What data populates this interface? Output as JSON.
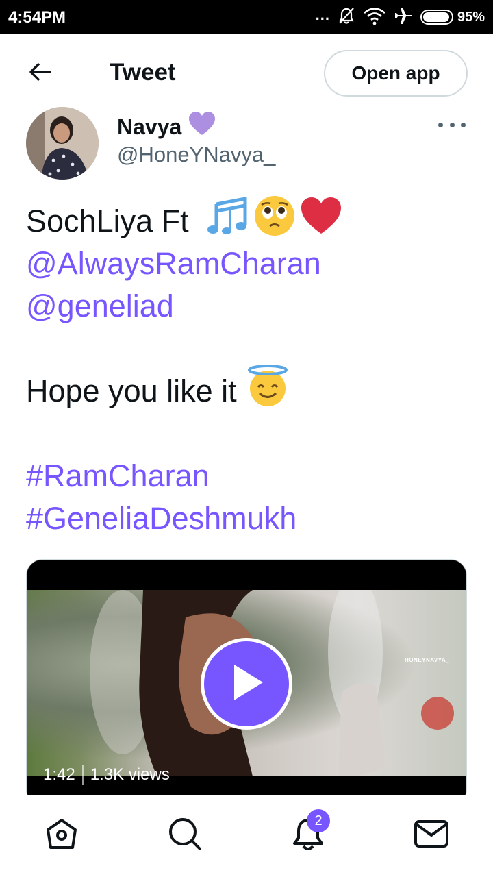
{
  "status_bar": {
    "time": "4:54PM",
    "dots": "...",
    "battery_percent": "95%",
    "icons": [
      "notifications-off-icon",
      "wifi-icon",
      "airplane-icon",
      "battery-icon"
    ]
  },
  "header": {
    "back_icon": "arrow-left-icon",
    "title": "Tweet",
    "open_app_label": "Open app"
  },
  "author": {
    "name": "Navya",
    "handle": "@HoneYNavya_",
    "badge_icon": "purple-heart-icon",
    "more_icon": "more-horizontal-icon"
  },
  "tweet": {
    "line1": "SochLiya Ft",
    "line1_emojis": [
      "musical-notes-icon",
      "pleading-face-icon",
      "red-heart-icon"
    ],
    "mention1": "@AlwaysRamCharan",
    "mention2": "@geneliad",
    "line_hope": "Hope you like it",
    "hope_emoji": "smiling-face-with-halo-icon",
    "hashtag1": "#RamCharan",
    "hashtag2": "#GeneliaDeshmukh"
  },
  "video": {
    "duration": "1:42",
    "views": "1.3K views",
    "watermark": "HONEYNAVYA_"
  },
  "bottom_nav": {
    "items": [
      "home-icon",
      "search-icon",
      "notifications-icon",
      "messages-icon"
    ],
    "notification_count": "2"
  },
  "colors": {
    "accent": "#7856ff",
    "text": "#0f1419",
    "secondary_text": "#536471",
    "border": "#cfd9de",
    "heart_badge": "#ac8fe0",
    "status_bar": "#000000"
  }
}
